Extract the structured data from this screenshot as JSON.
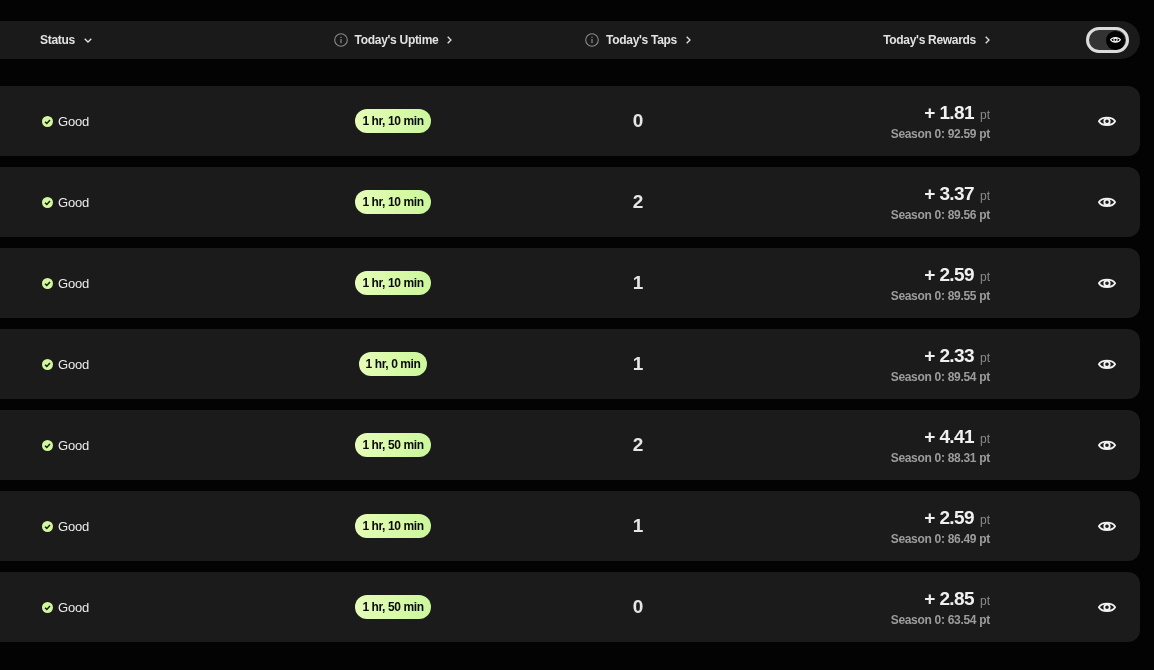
{
  "header": {
    "columns": [
      {
        "label": "Status",
        "kind": "dropdown",
        "info": false
      },
      {
        "label": "Today's Uptime",
        "kind": "link",
        "info": true
      },
      {
        "label": "Today's Taps",
        "kind": "link",
        "info": true
      },
      {
        "label": "Today's Rewards",
        "kind": "link",
        "info": false
      }
    ],
    "visibility_toggle": {
      "on": true
    }
  },
  "rows": [
    {
      "status": "Good",
      "uptime": "1 hr, 10 min",
      "taps": "0",
      "reward": "+ 1.81",
      "reward_unit": "pt",
      "season_total": "Season 0: 92.59 pt"
    },
    {
      "status": "Good",
      "uptime": "1 hr, 10 min",
      "taps": "2",
      "reward": "+ 3.37",
      "reward_unit": "pt",
      "season_total": "Season 0: 89.56 pt"
    },
    {
      "status": "Good",
      "uptime": "1 hr, 10 min",
      "taps": "1",
      "reward": "+ 2.59",
      "reward_unit": "pt",
      "season_total": "Season 0: 89.55 pt"
    },
    {
      "status": "Good",
      "uptime": "1 hr, 0 min",
      "taps": "1",
      "reward": "+ 2.33",
      "reward_unit": "pt",
      "season_total": "Season 0: 89.54 pt"
    },
    {
      "status": "Good",
      "uptime": "1 hr, 50 min",
      "taps": "2",
      "reward": "+ 4.41",
      "reward_unit": "pt",
      "season_total": "Season 0: 88.31 pt"
    },
    {
      "status": "Good",
      "uptime": "1 hr, 10 min",
      "taps": "1",
      "reward": "+ 2.59",
      "reward_unit": "pt",
      "season_total": "Season 0: 86.49 pt"
    },
    {
      "status": "Good",
      "uptime": "1 hr, 50 min",
      "taps": "0",
      "reward": "+ 2.85",
      "reward_unit": "pt",
      "season_total": "Season 0: 63.54 pt"
    }
  ]
}
